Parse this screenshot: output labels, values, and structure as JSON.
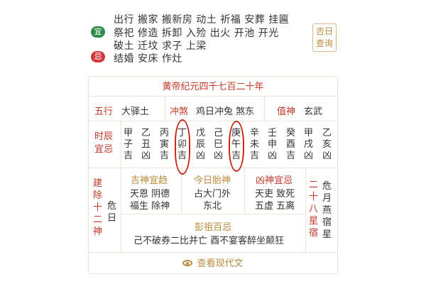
{
  "yi": {
    "badge": "宜",
    "lines": [
      "出行 搬家 搬新房 动土 祈福 安葬 挂匾",
      "祭祀 修造 拆卸 入殓 出火 开池 开光",
      "破土 迁坟 求子 上梁"
    ]
  },
  "ji": {
    "badge": "忌",
    "text": "结婚 安床 作灶"
  },
  "jiri_button": "吉日查询",
  "era": "黄帝纪元四千七百二十年",
  "wuxing": {
    "label": "五行",
    "value": "大驿土"
  },
  "chongsha": {
    "label": "冲煞",
    "value": "鸡日冲兔 煞东"
  },
  "zhishen": {
    "label": "值神",
    "value": "玄武"
  },
  "shichen": {
    "label": "时辰宜忌",
    "columns": [
      "甲子吉",
      "乙丑凶",
      "丙寅吉",
      "丁卯吉",
      "戊辰凶",
      "己巳凶",
      "庚午吉",
      "辛未吉",
      "壬申凶",
      "癸酉吉",
      "甲戌凶",
      "乙亥凶"
    ]
  },
  "jianchu": {
    "label": "建除十二神",
    "value": "危日"
  },
  "jishen": {
    "label": "吉神宜趋",
    "lines": [
      "天恩 阴德",
      "福生 除神"
    ]
  },
  "taishen": {
    "label": "今日胎神",
    "lines": [
      "占大门外",
      "东北"
    ]
  },
  "xiongshen": {
    "label": "凶神宜忌",
    "lines": [
      "天吏 致死",
      "五虚 五离"
    ]
  },
  "xiu": {
    "label": "二十八星宿",
    "value": "危月燕宿星"
  },
  "pengzu": {
    "label": "彭祖百忌",
    "value": "己不破券二比并亡 酉不宴客醉坐颠狂"
  },
  "view_modern": "查看现代文"
}
